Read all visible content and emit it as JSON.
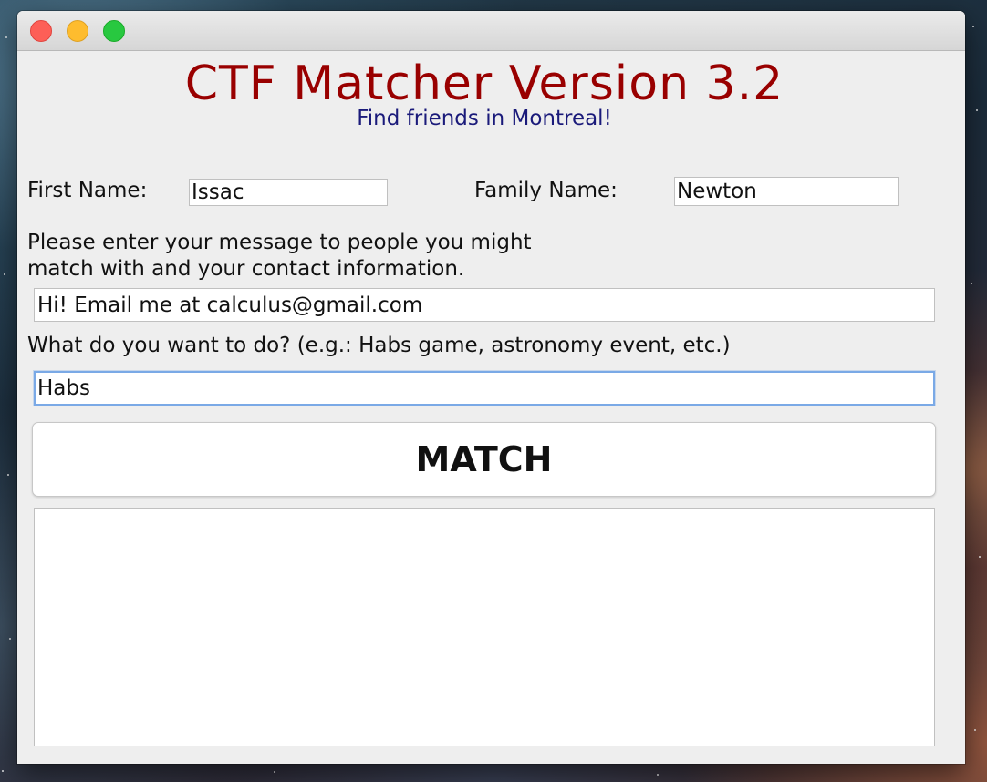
{
  "app": {
    "title": "CTF Matcher Version 3.2",
    "subtitle": "Find friends in Montreal!",
    "colors": {
      "title": "#990000",
      "subtitle": "#1a1a7a"
    }
  },
  "form": {
    "first_name_label": "First Name:",
    "first_name_value": "Issac",
    "family_name_label": "Family Name:",
    "family_name_value": "Newton",
    "message_label_line1": "Please enter your message to people you might",
    "message_label_line2": "match with and your contact information.",
    "message_value": "Hi! Email me at calculus@gmail.com",
    "activity_label": "What do you want to do? (e.g.: Habs game, astronomy event, etc.)",
    "activity_value": "Habs",
    "match_button_label": "MATCH",
    "results_value": ""
  },
  "window": {
    "controls": [
      "close-icon",
      "minimize-icon",
      "maximize-icon"
    ]
  }
}
